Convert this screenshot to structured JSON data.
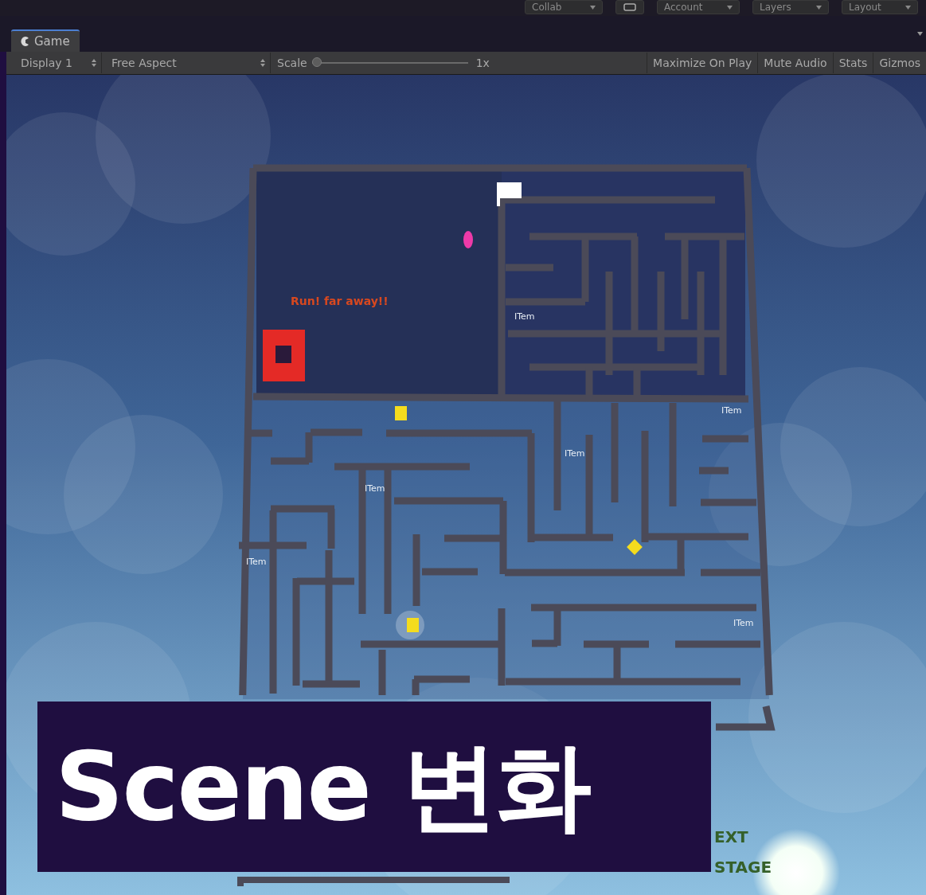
{
  "editor_toolbar": {
    "buttons": [
      {
        "kind": "dropdown",
        "label": "Collab"
      },
      {
        "kind": "icon"
      },
      {
        "kind": "dropdown",
        "label": "Account"
      },
      {
        "kind": "dropdown",
        "label": "Layers"
      },
      {
        "kind": "dropdown",
        "label": "Layout"
      }
    ]
  },
  "tabs": [
    {
      "label": "Game",
      "selected": true
    }
  ],
  "game_toolbar": {
    "display": "Display 1",
    "aspect": "Free Aspect",
    "scale_label": "Scale",
    "scale": {
      "level": 0
    },
    "scale_value": "1x",
    "toggles": [
      {
        "label": "Maximize On Play",
        "on": false
      },
      {
        "label": "Mute Audio",
        "on": false
      },
      {
        "label": "Stats",
        "on": false
      },
      {
        "label": "Gizmos",
        "on": false
      }
    ]
  },
  "game_view": {
    "hint": "Run! far away!!",
    "item_labels": [
      "ITem",
      "ITem",
      "ITem",
      "ITem",
      "ITem",
      "ITem"
    ],
    "exit_label": [
      "EXT",
      "STAGE"
    ]
  },
  "caption": "Scene 변화"
}
